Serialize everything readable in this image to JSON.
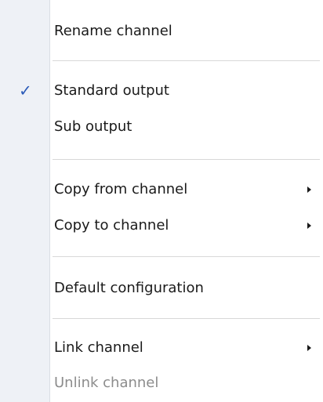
{
  "menu": {
    "rename_channel": "Rename channel",
    "standard_output": "Standard output",
    "standard_output_checked": true,
    "check_mark": "✓",
    "sub_output": "Sub output",
    "copy_from_channel": "Copy from channel",
    "copy_to_channel": "Copy to channel",
    "default_configuration": "Default configuration",
    "link_channel": "Link channel",
    "unlink_channel": "Unlink channel",
    "unlink_channel_disabled": true,
    "submenu_arrow_icon": "submenu-arrow-icon",
    "accent_color": "#2a5ab8",
    "gutter_color": "#eef1f6"
  }
}
